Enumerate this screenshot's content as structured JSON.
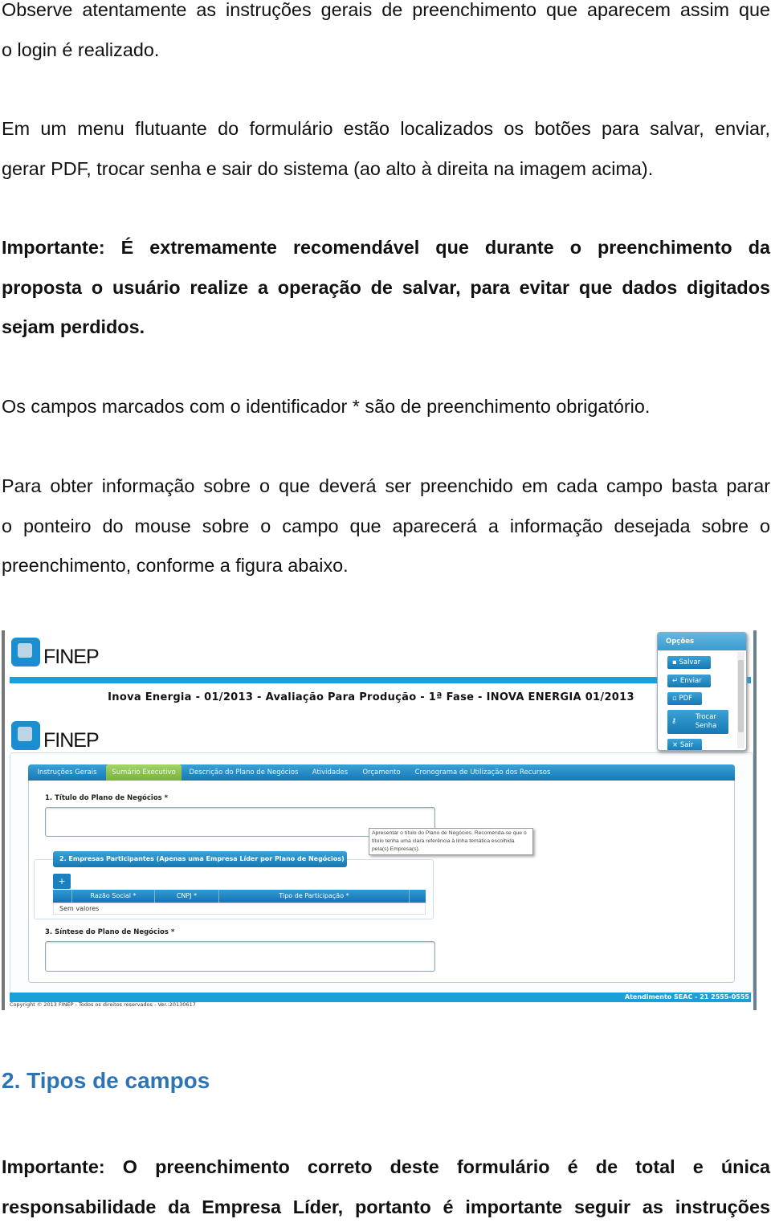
{
  "paragraphs": [
    {
      "lines": [
        "Observe atentamente as instruções gerais de preenchimento que aparecem assim que",
        "o login é realizado."
      ]
    },
    {
      "lines": [
        "Em um menu flutuante do formulário estão localizados os botões para salvar, enviar,",
        "gerar PDF, trocar senha e sair do sistema (ao alto à direita na imagem acima)."
      ]
    },
    {
      "lines": [
        "Importante: É extremamente recomendável que durante o preenchimento da",
        "proposta o usuário realize a operação de salvar, para evitar que dados digitados",
        "sejam perdidos."
      ]
    },
    {
      "text": "Os campos marcados com o identificador * são de preenchimento obrigatório."
    },
    {
      "lines": [
        "Para obter informação sobre o que deverá ser preenchido em cada campo basta parar",
        "o ponteiro do mouse sobre o campo que aparecerá a informação desejada sobre o",
        "preenchimento, conforme a figura abaixo."
      ]
    }
  ],
  "section_heading": "2. Tipos de campos",
  "final_paragraph": {
    "lines": [
      "Importante: O preenchimento correto deste formulário é de total e única",
      "responsabilidade da Empresa Líder, portanto é importante seguir as instruções"
    ]
  },
  "screenshot": {
    "logo_text": "FINEP",
    "title": "Inova Energia - 01/2013 - Avaliação Para Produção - 1ª Fase - INOVA ENERGIA 01/2013",
    "tabs": [
      "Instruções Gerais",
      "Sumário Executivo",
      "Descrição do Plano de Negócios",
      "Atividades",
      "Orçamento",
      "Cronograma de Utilização dos Recursos"
    ],
    "active_tab": "Sumário Executivo",
    "field1_label": "1. Título do Plano de Negócios *",
    "tooltip": "Apresentar o título do Plano de Negócios. Recomenda-se que o título tenha uma clara referência à linha temática escolhida pela(s) Empresa(s).",
    "section2_legend": "2. Empresas Participantes (Apenas uma Empresa Líder por Plano de Negócios)",
    "add_button": "+",
    "table_headers": [
      "Razão Social *",
      "CNPJ *",
      "Tipo de Participação *"
    ],
    "empty_text": "Sem valores",
    "field3_label": "3. Síntese do Plano de Negócios *",
    "footer_contact": "Atendimento SEAC - 21 2555-0555",
    "copyright": "Copyright © 2013 FINEP - Todos os direitos reservados - Ver.:20130617",
    "options": {
      "title": "Opções",
      "buttons": [
        {
          "icon": "save-icon",
          "glyph": "▪",
          "label": "Salvar"
        },
        {
          "icon": "send-icon",
          "glyph": "↵",
          "label": "Enviar"
        },
        {
          "icon": "pdf-icon",
          "glyph": "▫",
          "label": "PDF"
        },
        {
          "icon": "key-icon",
          "glyph": "⚷",
          "label": "Trocar Senha"
        },
        {
          "icon": "close-icon",
          "glyph": "×",
          "label": "Sair"
        }
      ]
    },
    "colors": {
      "brand_blue": "#1a9fd8",
      "active_tab": "#8bc34a",
      "heading": "#2e74b5"
    }
  }
}
